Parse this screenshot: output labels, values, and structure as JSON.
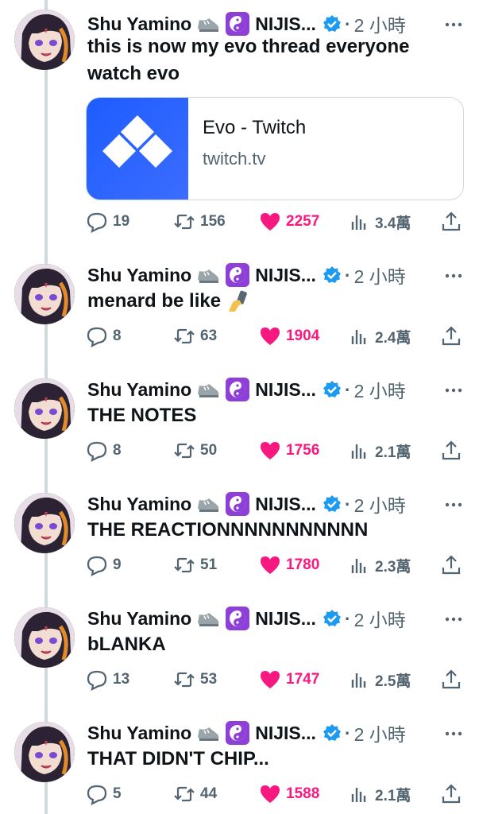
{
  "author": {
    "name": "Shu Yamino",
    "org": "NIJIS...",
    "time_dot": "·",
    "time": "2 小時"
  },
  "card": {
    "title": "Evo - Twitch",
    "domain": "twitch.tv"
  },
  "colors": {
    "like": "#f91880",
    "verified": "#1d9bf0",
    "muted": "#536471",
    "evo_blue": "#1e5cff"
  },
  "icons": [
    "shoe-emoji-icon",
    "yin-yang-emoji-icon",
    "verified-badge-icon",
    "more-icon",
    "reply-icon",
    "retweet-icon",
    "like-icon",
    "views-icon",
    "share-icon",
    "selfie-emoji-icon"
  ],
  "tweets": [
    {
      "text_line1": "this is now my evo thread everyone",
      "text_line2": "watch evo",
      "replies": "19",
      "retweets": "156",
      "likes": "2257",
      "views": "3.4萬"
    },
    {
      "text_line1": "menard be like",
      "replies": "8",
      "retweets": "63",
      "likes": "1904",
      "views": "2.4萬"
    },
    {
      "text_line1": "THE NOTES",
      "replies": "8",
      "retweets": "50",
      "likes": "1756",
      "views": "2.1萬"
    },
    {
      "text_line1": "THE REACTIONNNNNNNNNNN",
      "replies": "9",
      "retweets": "51",
      "likes": "1780",
      "views": "2.3萬"
    },
    {
      "text_line1": "bLANKA",
      "replies": "13",
      "retweets": "53",
      "likes": "1747",
      "views": "2.5萬"
    },
    {
      "text_line1": "THAT DIDN'T CHIP...",
      "replies": "5",
      "retweets": "44",
      "likes": "1588",
      "views": "2.1萬"
    }
  ]
}
